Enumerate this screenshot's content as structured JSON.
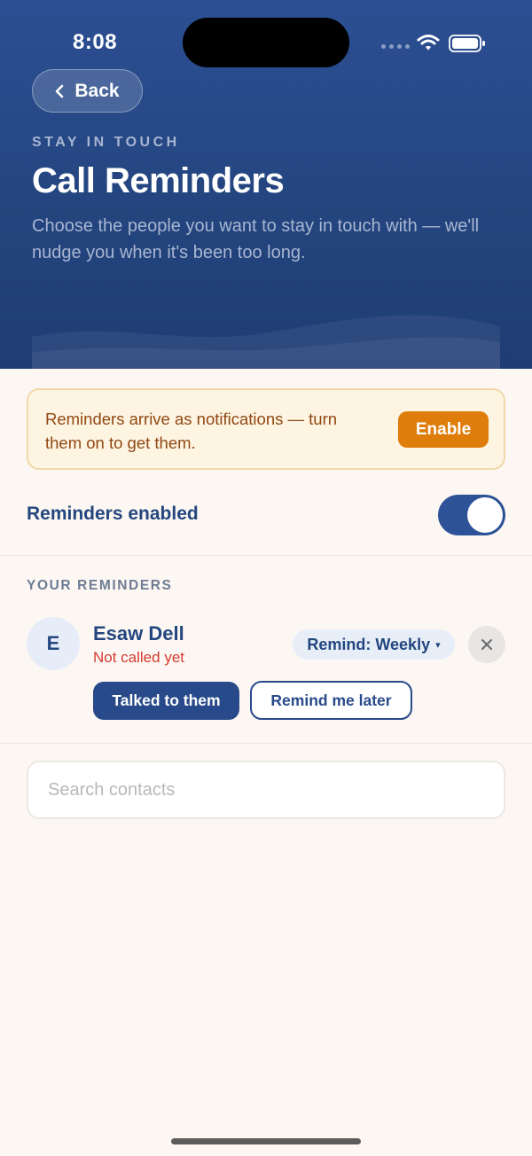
{
  "status_bar": {
    "time": "8:08"
  },
  "header": {
    "back_label": "Back",
    "eyebrow": "STAY IN TOUCH",
    "title": "Call Reminders",
    "subtitle": "Choose the people you want to stay in touch with — we'll nudge you when it's been too long."
  },
  "banner": {
    "text": "Reminders arrive as notifications — turn them on to get them.",
    "button_label": "Enable"
  },
  "toggle": {
    "label": "Reminders enabled",
    "enabled": true
  },
  "reminders": {
    "section_title": "YOUR REMINDERS",
    "items": [
      {
        "initial": "E",
        "name": "Esaw Dell",
        "status": "Not called yet",
        "frequency": "Remind: Weekly",
        "primary_action": "Talked to them",
        "secondary_action": "Remind me later"
      }
    ]
  },
  "search": {
    "placeholder": "Search contacts",
    "value": ""
  },
  "colors": {
    "header": "#24457f",
    "accent": "#284a8a",
    "warning": "#df7d0b",
    "status_red": "#d33a31",
    "background": "#fcf7f2"
  },
  "icons": {
    "back": "chevron-left-icon",
    "remove": "close-icon",
    "wifi": "wifi-icon",
    "battery": "battery-icon"
  }
}
